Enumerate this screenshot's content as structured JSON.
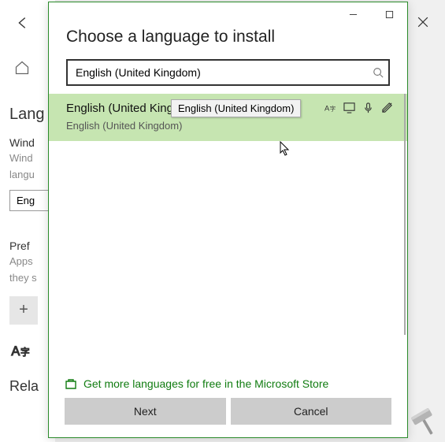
{
  "bg": {
    "section": "Lang",
    "sub1": "Wind",
    "text1a": "Wind",
    "text1b": "langu",
    "input": "Eng",
    "sub2": "Pref",
    "text2a": "Apps",
    "text2b": "they s",
    "rel": "Rela"
  },
  "dialog": {
    "title": "Choose a language to install",
    "search_value": "English (United Kingdom)",
    "item": {
      "name": "English (United King",
      "sub": "English (United Kingdom)"
    },
    "tooltip": "English (United Kingdom)",
    "store_link": "Get more languages for free in the Microsoft Store",
    "next": "Next",
    "cancel": "Cancel"
  }
}
